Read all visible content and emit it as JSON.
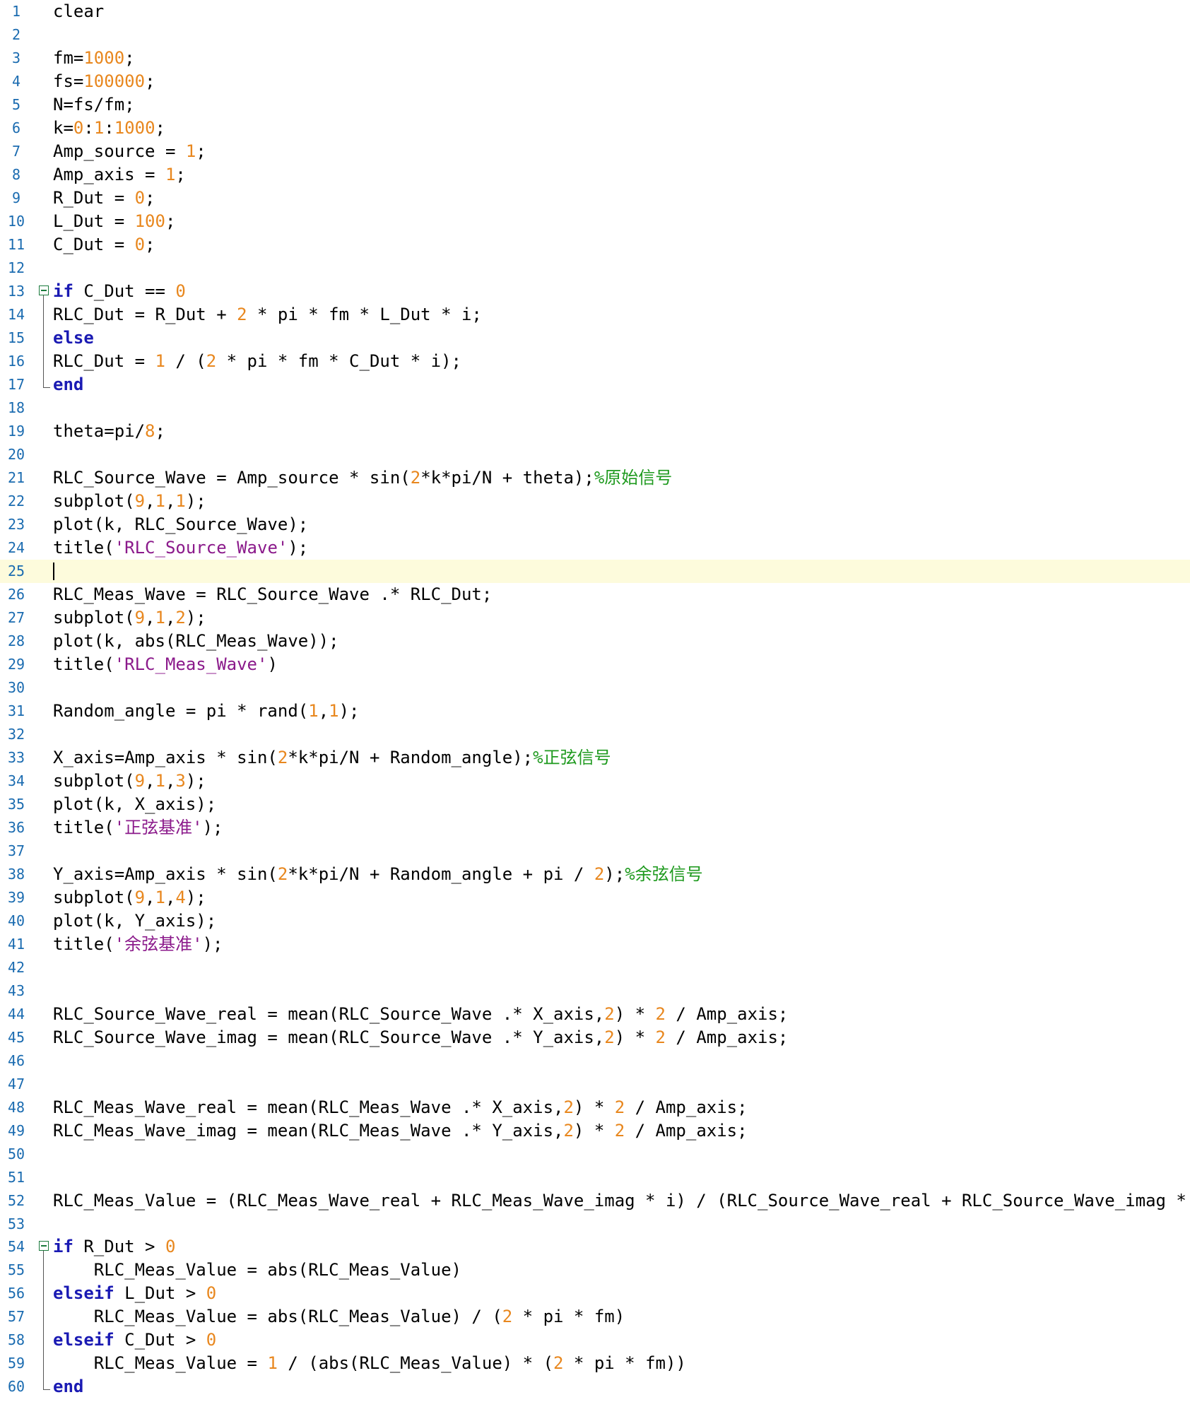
{
  "editor": {
    "current_line": 25,
    "lines": [
      {
        "n": "1",
        "code": [
          {
            "t": "clear",
            "c": "plain"
          }
        ]
      },
      {
        "n": "2",
        "code": []
      },
      {
        "n": "3",
        "code": [
          {
            "t": "fm=",
            "c": "plain"
          },
          {
            "t": "1000",
            "c": "num"
          },
          {
            "t": ";",
            "c": "plain"
          }
        ]
      },
      {
        "n": "4",
        "code": [
          {
            "t": "fs=",
            "c": "plain"
          },
          {
            "t": "100000",
            "c": "num"
          },
          {
            "t": ";",
            "c": "plain"
          }
        ]
      },
      {
        "n": "5",
        "code": [
          {
            "t": "N=fs/fm;",
            "c": "plain"
          }
        ]
      },
      {
        "n": "6",
        "code": [
          {
            "t": "k=",
            "c": "plain"
          },
          {
            "t": "0",
            "c": "num"
          },
          {
            "t": ":",
            "c": "plain"
          },
          {
            "t": "1",
            "c": "num"
          },
          {
            "t": ":",
            "c": "plain"
          },
          {
            "t": "1000",
            "c": "num"
          },
          {
            "t": ";",
            "c": "plain"
          }
        ]
      },
      {
        "n": "7",
        "code": [
          {
            "t": "Amp_source = ",
            "c": "plain"
          },
          {
            "t": "1",
            "c": "num"
          },
          {
            "t": ";",
            "c": "plain"
          }
        ]
      },
      {
        "n": "8",
        "code": [
          {
            "t": "Amp_axis = ",
            "c": "plain"
          },
          {
            "t": "1",
            "c": "num"
          },
          {
            "t": ";",
            "c": "plain"
          }
        ]
      },
      {
        "n": "9",
        "code": [
          {
            "t": "R_Dut = ",
            "c": "plain"
          },
          {
            "t": "0",
            "c": "num"
          },
          {
            "t": ";",
            "c": "plain"
          }
        ]
      },
      {
        "n": "10",
        "code": [
          {
            "t": "L_Dut = ",
            "c": "plain"
          },
          {
            "t": "100",
            "c": "num"
          },
          {
            "t": ";",
            "c": "plain"
          }
        ]
      },
      {
        "n": "11",
        "code": [
          {
            "t": "C_Dut = ",
            "c": "plain"
          },
          {
            "t": "0",
            "c": "num"
          },
          {
            "t": ";",
            "c": "plain"
          }
        ]
      },
      {
        "n": "12",
        "code": []
      },
      {
        "n": "13",
        "fold": "start",
        "code": [
          {
            "t": "if",
            "c": "kw"
          },
          {
            "t": " C_Dut == ",
            "c": "plain"
          },
          {
            "t": "0",
            "c": "num"
          }
        ]
      },
      {
        "n": "14",
        "code": [
          {
            "t": "RLC_Dut = R_Dut + ",
            "c": "plain"
          },
          {
            "t": "2",
            "c": "num"
          },
          {
            "t": " * pi * fm * L_Dut * i;",
            "c": "plain"
          }
        ]
      },
      {
        "n": "15",
        "code": [
          {
            "t": "else",
            "c": "kw"
          }
        ]
      },
      {
        "n": "16",
        "code": [
          {
            "t": "RLC_Dut = ",
            "c": "plain"
          },
          {
            "t": "1",
            "c": "num"
          },
          {
            "t": " / (",
            "c": "plain"
          },
          {
            "t": "2",
            "c": "num"
          },
          {
            "t": " * pi * fm * C_Dut * i);",
            "c": "plain"
          }
        ]
      },
      {
        "n": "17",
        "fold": "end",
        "code": [
          {
            "t": "end",
            "c": "kw"
          }
        ]
      },
      {
        "n": "18",
        "code": []
      },
      {
        "n": "19",
        "code": [
          {
            "t": "theta=pi/",
            "c": "plain"
          },
          {
            "t": "8",
            "c": "num"
          },
          {
            "t": ";",
            "c": "plain"
          }
        ]
      },
      {
        "n": "20",
        "code": []
      },
      {
        "n": "21",
        "code": [
          {
            "t": "RLC_Source_Wave = Amp_source * sin(",
            "c": "plain"
          },
          {
            "t": "2",
            "c": "num"
          },
          {
            "t": "*k*pi/N + theta);",
            "c": "plain"
          },
          {
            "t": "%原始信号",
            "c": "cmt"
          }
        ]
      },
      {
        "n": "22",
        "code": [
          {
            "t": "subplot(",
            "c": "plain"
          },
          {
            "t": "9",
            "c": "num"
          },
          {
            "t": ",",
            "c": "plain"
          },
          {
            "t": "1",
            "c": "num"
          },
          {
            "t": ",",
            "c": "plain"
          },
          {
            "t": "1",
            "c": "num"
          },
          {
            "t": ");",
            "c": "plain"
          }
        ]
      },
      {
        "n": "23",
        "code": [
          {
            "t": "plot(k, RLC_Source_Wave);",
            "c": "plain"
          }
        ]
      },
      {
        "n": "24",
        "code": [
          {
            "t": "title(",
            "c": "plain"
          },
          {
            "t": "'RLC_Source_Wave'",
            "c": "str"
          },
          {
            "t": ");",
            "c": "plain"
          }
        ]
      },
      {
        "n": "25",
        "code": []
      },
      {
        "n": "26",
        "code": [
          {
            "t": "RLC_Meas_Wave = RLC_Source_Wave .* RLC_Dut;",
            "c": "plain"
          }
        ]
      },
      {
        "n": "27",
        "code": [
          {
            "t": "subplot(",
            "c": "plain"
          },
          {
            "t": "9",
            "c": "num"
          },
          {
            "t": ",",
            "c": "plain"
          },
          {
            "t": "1",
            "c": "num"
          },
          {
            "t": ",",
            "c": "plain"
          },
          {
            "t": "2",
            "c": "num"
          },
          {
            "t": ");",
            "c": "plain"
          }
        ]
      },
      {
        "n": "28",
        "code": [
          {
            "t": "plot(k, abs(RLC_Meas_Wave));",
            "c": "plain"
          }
        ]
      },
      {
        "n": "29",
        "code": [
          {
            "t": "title(",
            "c": "plain"
          },
          {
            "t": "'RLC_Meas_Wave'",
            "c": "str"
          },
          {
            "t": ")",
            "c": "plain"
          }
        ]
      },
      {
        "n": "30",
        "code": []
      },
      {
        "n": "31",
        "code": [
          {
            "t": "Random_angle = pi * rand(",
            "c": "plain"
          },
          {
            "t": "1",
            "c": "num"
          },
          {
            "t": ",",
            "c": "plain"
          },
          {
            "t": "1",
            "c": "num"
          },
          {
            "t": ");",
            "c": "plain"
          }
        ]
      },
      {
        "n": "32",
        "code": []
      },
      {
        "n": "33",
        "code": [
          {
            "t": "X_axis=Amp_axis * sin(",
            "c": "plain"
          },
          {
            "t": "2",
            "c": "num"
          },
          {
            "t": "*k*pi/N + Random_angle);",
            "c": "plain"
          },
          {
            "t": "%正弦信号",
            "c": "cmt"
          }
        ]
      },
      {
        "n": "34",
        "code": [
          {
            "t": "subplot(",
            "c": "plain"
          },
          {
            "t": "9",
            "c": "num"
          },
          {
            "t": ",",
            "c": "plain"
          },
          {
            "t": "1",
            "c": "num"
          },
          {
            "t": ",",
            "c": "plain"
          },
          {
            "t": "3",
            "c": "num"
          },
          {
            "t": ");",
            "c": "plain"
          }
        ]
      },
      {
        "n": "35",
        "code": [
          {
            "t": "plot(k, X_axis);",
            "c": "plain"
          }
        ]
      },
      {
        "n": "36",
        "code": [
          {
            "t": "title(",
            "c": "plain"
          },
          {
            "t": "'正弦基准'",
            "c": "str"
          },
          {
            "t": ");",
            "c": "plain"
          }
        ]
      },
      {
        "n": "37",
        "code": []
      },
      {
        "n": "38",
        "code": [
          {
            "t": "Y_axis=Amp_axis * sin(",
            "c": "plain"
          },
          {
            "t": "2",
            "c": "num"
          },
          {
            "t": "*k*pi/N + Random_angle + pi / ",
            "c": "plain"
          },
          {
            "t": "2",
            "c": "num"
          },
          {
            "t": ");",
            "c": "plain"
          },
          {
            "t": "%余弦信号",
            "c": "cmt"
          }
        ]
      },
      {
        "n": "39",
        "code": [
          {
            "t": "subplot(",
            "c": "plain"
          },
          {
            "t": "9",
            "c": "num"
          },
          {
            "t": ",",
            "c": "plain"
          },
          {
            "t": "1",
            "c": "num"
          },
          {
            "t": ",",
            "c": "plain"
          },
          {
            "t": "4",
            "c": "num"
          },
          {
            "t": ");",
            "c": "plain"
          }
        ]
      },
      {
        "n": "40",
        "code": [
          {
            "t": "plot(k, Y_axis);",
            "c": "plain"
          }
        ]
      },
      {
        "n": "41",
        "code": [
          {
            "t": "title(",
            "c": "plain"
          },
          {
            "t": "'余弦基准'",
            "c": "str"
          },
          {
            "t": ");",
            "c": "plain"
          }
        ]
      },
      {
        "n": "42",
        "code": []
      },
      {
        "n": "43",
        "code": []
      },
      {
        "n": "44",
        "code": [
          {
            "t": "RLC_Source_Wave_real = mean(RLC_Source_Wave .* X_axis,",
            "c": "plain"
          },
          {
            "t": "2",
            "c": "num"
          },
          {
            "t": ") * ",
            "c": "plain"
          },
          {
            "t": "2",
            "c": "num"
          },
          {
            "t": " / Amp_axis;",
            "c": "plain"
          }
        ]
      },
      {
        "n": "45",
        "code": [
          {
            "t": "RLC_Source_Wave_imag = mean(RLC_Source_Wave .* Y_axis,",
            "c": "plain"
          },
          {
            "t": "2",
            "c": "num"
          },
          {
            "t": ") * ",
            "c": "plain"
          },
          {
            "t": "2",
            "c": "num"
          },
          {
            "t": " / Amp_axis;",
            "c": "plain"
          }
        ]
      },
      {
        "n": "46",
        "code": []
      },
      {
        "n": "47",
        "code": []
      },
      {
        "n": "48",
        "code": [
          {
            "t": "RLC_Meas_Wave_real = mean(RLC_Meas_Wave .* X_axis,",
            "c": "plain"
          },
          {
            "t": "2",
            "c": "num"
          },
          {
            "t": ") * ",
            "c": "plain"
          },
          {
            "t": "2",
            "c": "num"
          },
          {
            "t": " / Amp_axis;",
            "c": "plain"
          }
        ]
      },
      {
        "n": "49",
        "code": [
          {
            "t": "RLC_Meas_Wave_imag = mean(RLC_Meas_Wave .* Y_axis,",
            "c": "plain"
          },
          {
            "t": "2",
            "c": "num"
          },
          {
            "t": ") * ",
            "c": "plain"
          },
          {
            "t": "2",
            "c": "num"
          },
          {
            "t": " / Amp_axis;",
            "c": "plain"
          }
        ]
      },
      {
        "n": "50",
        "code": []
      },
      {
        "n": "51",
        "code": []
      },
      {
        "n": "52",
        "code": [
          {
            "t": "RLC_Meas_Value = (RLC_Meas_Wave_real + RLC_Meas_Wave_imag * i) / (RLC_Source_Wave_real + RLC_Source_Wave_imag * i)",
            "c": "plain"
          }
        ]
      },
      {
        "n": "53",
        "code": []
      },
      {
        "n": "54",
        "fold": "start",
        "code": [
          {
            "t": "if",
            "c": "kw"
          },
          {
            "t": " R_Dut > ",
            "c": "plain"
          },
          {
            "t": "0",
            "c": "num"
          }
        ]
      },
      {
        "n": "55",
        "code": [
          {
            "t": "    RLC_Meas_Value = abs(RLC_Meas_Value)",
            "c": "plain"
          }
        ]
      },
      {
        "n": "56",
        "code": [
          {
            "t": "elseif",
            "c": "kw"
          },
          {
            "t": " L_Dut > ",
            "c": "plain"
          },
          {
            "t": "0",
            "c": "num"
          }
        ]
      },
      {
        "n": "57",
        "code": [
          {
            "t": "    RLC_Meas_Value = abs(RLC_Meas_Value) / (",
            "c": "plain"
          },
          {
            "t": "2",
            "c": "num"
          },
          {
            "t": " * pi * fm)",
            "c": "plain"
          }
        ]
      },
      {
        "n": "58",
        "code": [
          {
            "t": "elseif",
            "c": "kw"
          },
          {
            "t": " C_Dut > ",
            "c": "plain"
          },
          {
            "t": "0",
            "c": "num"
          }
        ]
      },
      {
        "n": "59",
        "code": [
          {
            "t": "    RLC_Meas_Value = ",
            "c": "plain"
          },
          {
            "t": "1",
            "c": "num"
          },
          {
            "t": " / (abs(RLC_Meas_Value) * (",
            "c": "plain"
          },
          {
            "t": "2",
            "c": "num"
          },
          {
            "t": " * pi * fm))",
            "c": "plain"
          }
        ]
      },
      {
        "n": "60",
        "fold": "end",
        "code": [
          {
            "t": "end",
            "c": "kw"
          }
        ]
      }
    ]
  },
  "colors": {
    "keyword": "#1a1ab3",
    "number": "#e8871e",
    "string": "#8b1a8b",
    "comment": "#1f9a1f",
    "line_number": "#1a6bb0",
    "current_line_bg": "#fdfbdc"
  }
}
